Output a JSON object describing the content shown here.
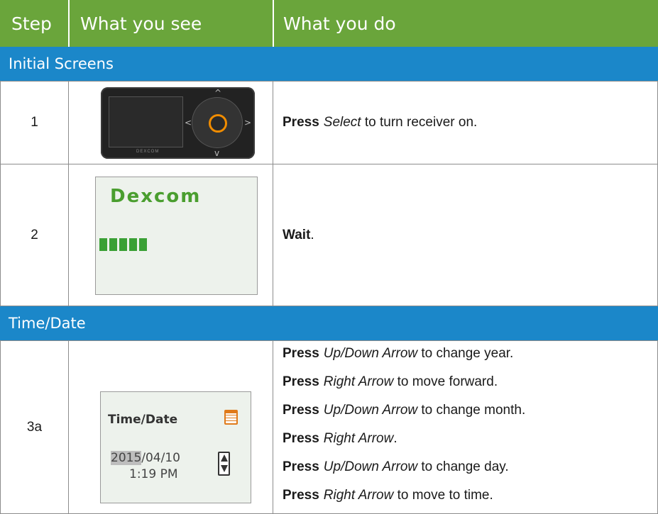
{
  "header": {
    "step": "Step",
    "what_you_see": "What you see",
    "what_you_do": "What you do"
  },
  "sections": {
    "initial": "Initial Screens",
    "timedate": "Time/Date"
  },
  "rows": {
    "r1": {
      "step": "1",
      "verb": "Press",
      "obj": "Select",
      "rest": "to turn receiver on."
    },
    "r2": {
      "step": "2",
      "verb": "Wait",
      "rest": "."
    },
    "r3a": {
      "step": "3a",
      "lines": [
        {
          "verb": "Press",
          "obj": "Up/Down Arrow",
          "rest": "to change year."
        },
        {
          "verb": "Press",
          "obj": "Right Arrow",
          "rest": "to move forward."
        },
        {
          "verb": "Press",
          "obj": "Up/Down Arrow",
          "rest": "to change month."
        },
        {
          "verb": "Press",
          "obj": "Right Arrow",
          "rest": "."
        },
        {
          "verb": "Press",
          "obj": "Up/Down Arrow",
          "rest": "to change day."
        },
        {
          "verb": "Press",
          "obj": "Right Arrow",
          "rest": "to move to time."
        }
      ]
    }
  },
  "device": {
    "brand": "DEXCOM",
    "up": "^",
    "down": "v",
    "left": "<",
    "right": ">"
  },
  "splash": {
    "logo": "Dexcom"
  },
  "timedate_screen": {
    "title": "Time/Date",
    "year": "2015",
    "date_rest": "/04/10",
    "time": "1:19 PM"
  },
  "colors": {
    "header": "#6aa53b",
    "section": "#1b87c9",
    "select_ring": "#f08c00"
  }
}
